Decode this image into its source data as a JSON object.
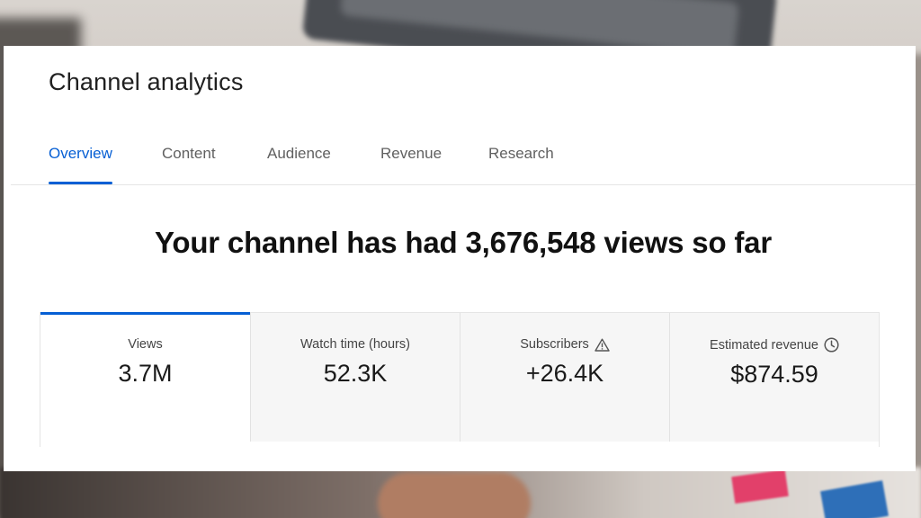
{
  "page": {
    "title": "Channel analytics"
  },
  "tabs": [
    {
      "label": "Overview",
      "active": true
    },
    {
      "label": "Content"
    },
    {
      "label": "Audience"
    },
    {
      "label": "Revenue"
    },
    {
      "label": "Research"
    }
  ],
  "headline": "Your channel has had 3,676,548 views so far",
  "metrics": [
    {
      "label": "Views",
      "value": "3.7M",
      "selected": true
    },
    {
      "label": "Watch time (hours)",
      "value": "52.3K"
    },
    {
      "label": "Subscribers",
      "value": "+26.4K",
      "icon": "warning-icon"
    },
    {
      "label": "Estimated revenue",
      "value": "$874.59",
      "icon": "clock-icon"
    }
  ],
  "colors": {
    "accent": "#065fd4",
    "card_background": "#f6f6f6"
  }
}
